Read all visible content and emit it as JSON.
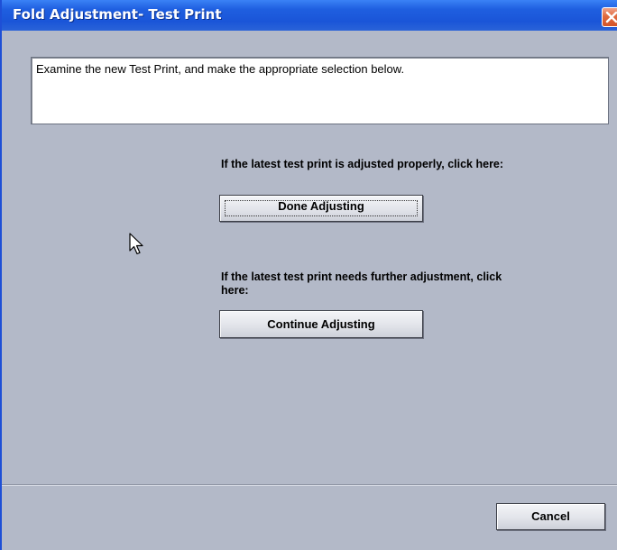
{
  "window": {
    "title": "Fold Adjustment- Test Print"
  },
  "message": {
    "text": "Examine the new Test Print, and make the appropriate selection below."
  },
  "done_section": {
    "prompt": "If the latest test print is adjusted properly, click here:",
    "button_label": "Done Adjusting"
  },
  "continue_section": {
    "prompt": "If the latest test print needs further adjustment, click here:",
    "button_label": "Continue Adjusting"
  },
  "footer": {
    "cancel_label": "Cancel"
  },
  "icons": {
    "close": "close-icon",
    "cursor": "mouse-pointer-icon"
  },
  "colors": {
    "titlebar": "#1f5fe0",
    "background": "#b3b9c8",
    "close_button": "#e06a3e"
  }
}
